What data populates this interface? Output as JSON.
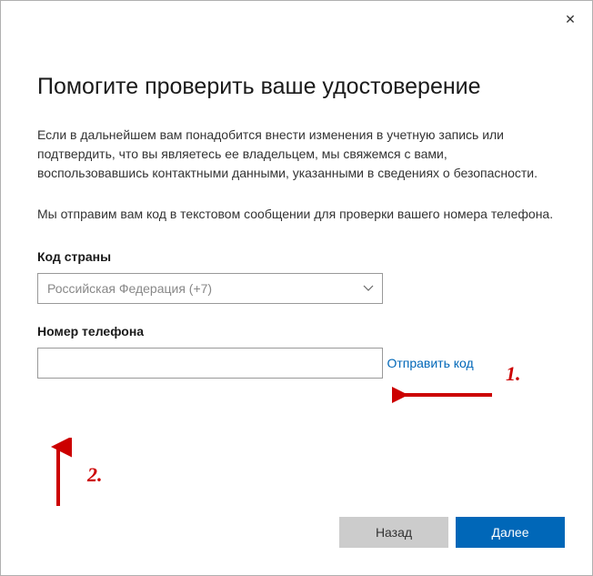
{
  "window": {
    "close_symbol": "✕"
  },
  "title": "Помогите проверить ваше удостоверение",
  "description": "Если в дальнейшем вам понадобится внести изменения в учетную запись или подтвердить, что вы являетесь ее владельцем, мы свяжемся с вами, воспользовавшись контактными данными, указанными в сведениях о безопасности.",
  "sub_description": "Мы отправим вам код в текстовом сообщении для проверки вашего номера телефона.",
  "country_code": {
    "label": "Код страны",
    "selected": "Российская Федерация (+7)"
  },
  "phone": {
    "label": "Номер телефона",
    "value": ""
  },
  "send_code_link": "Отправить код",
  "buttons": {
    "back": "Назад",
    "next": "Далее"
  },
  "annotations": {
    "one": "1.",
    "two": "2."
  }
}
